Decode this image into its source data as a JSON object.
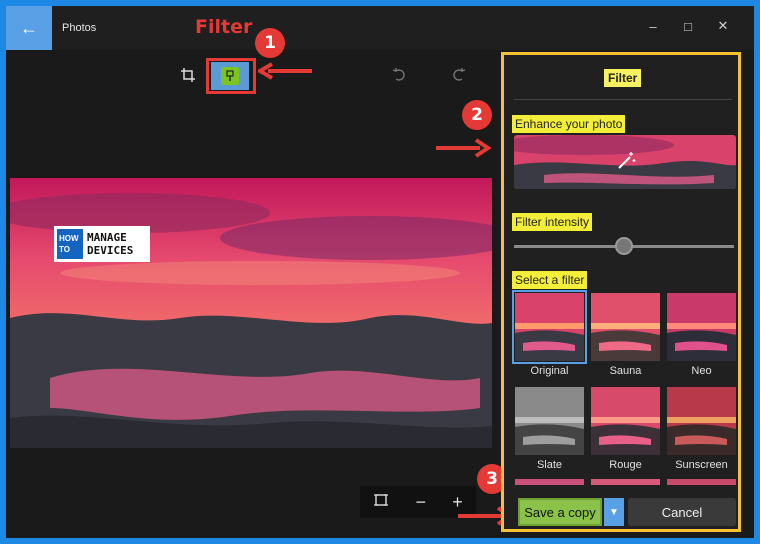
{
  "window": {
    "back_icon": "back-arrow-icon",
    "app_title": "Photos",
    "controls": [
      "minimize-icon",
      "maximize-icon",
      "close-icon"
    ]
  },
  "annotations": {
    "filter_label": "Filter",
    "badge1": "1",
    "badge2": "2",
    "badge3": "3",
    "accent_red": "#e53935",
    "highlight_yellow": "#f3ee3a"
  },
  "toolbar": {
    "crop_icon": "crop-icon",
    "filter_icon": "filter-brush-icon",
    "undo_icon": "undo-icon",
    "redo_icon": "redo-icon"
  },
  "photo": {
    "logo_top_left": "HOW",
    "logo_bottom_left": "TO",
    "logo_top_right": "MANAGE",
    "logo_bottom_right": "DEVICES"
  },
  "zoombar": {
    "fit_icon": "fit-to-window-icon",
    "zoom_out": "−",
    "zoom_in": "+"
  },
  "panel": {
    "title": "Filter",
    "enhance_label": "Enhance your photo",
    "enhance_icon": "magic-wand-icon",
    "intensity_label": "Filter intensity",
    "intensity_value": 0.5,
    "select_label": "Select a filter",
    "filters": [
      {
        "label": "Original",
        "selected": true
      },
      {
        "label": "Sauna",
        "selected": false
      },
      {
        "label": "Neo",
        "selected": false
      },
      {
        "label": "Slate",
        "selected": false
      },
      {
        "label": "Rouge",
        "selected": false
      },
      {
        "label": "Sunscreen",
        "selected": false
      }
    ],
    "save_label": "Save a copy",
    "dropdown_icon": "chevron-down-icon",
    "cancel_label": "Cancel"
  }
}
